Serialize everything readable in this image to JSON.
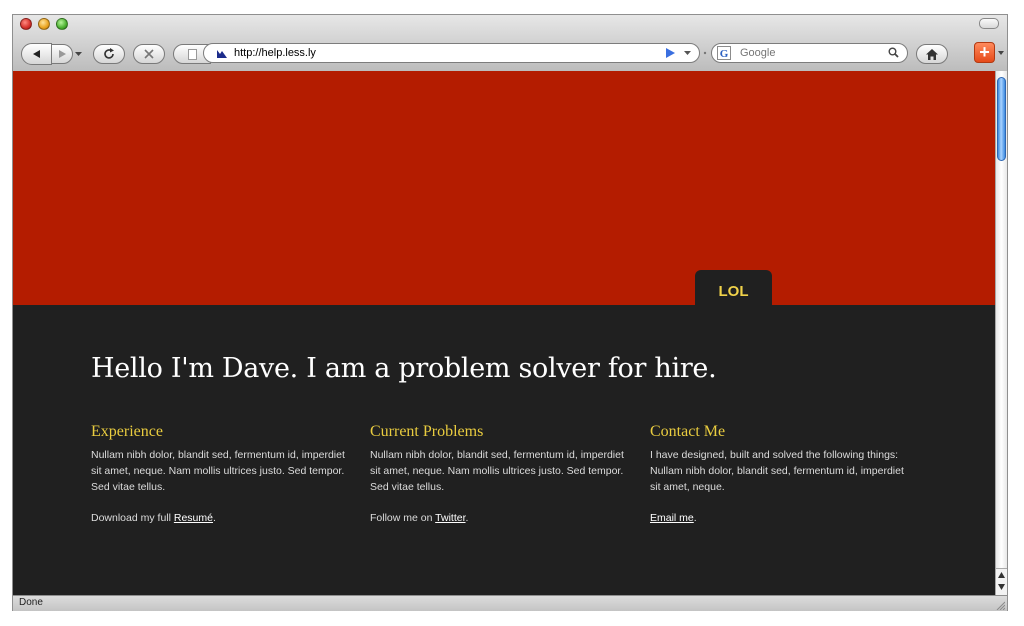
{
  "browser": {
    "url": "http://help.less.ly",
    "search_placeholder": "Google",
    "status": "Done"
  },
  "page": {
    "tab_label": "LOL",
    "headline": "Hello I'm Dave. I am a problem solver for hire.",
    "columns": [
      {
        "title": "Experience",
        "body": "Nullam nibh dolor, blandit sed, fermentum id, imperdiet sit amet, neque. Nam mollis ultrices justo. Sed tempor. Sed vitae tellus.",
        "foot_prefix": "Download my full ",
        "link": "Resumé",
        "foot_suffix": "."
      },
      {
        "title": "Current Problems",
        "body": "Nullam nibh dolor, blandit sed, fermentum id, imperdiet sit amet, neque. Nam mollis ultrices justo. Sed tempor. Sed vitae tellus.",
        "foot_prefix": "Follow me on ",
        "link": "Twitter",
        "foot_suffix": "."
      },
      {
        "title": "Contact Me",
        "body": "I have designed, built and solved the following things: Nullam nibh dolor, blandit sed, fermentum id, imperdiet sit amet, neque.",
        "foot_prefix": "",
        "link": "Email me",
        "foot_suffix": "."
      }
    ]
  },
  "colors": {
    "hero": "#b41c00",
    "content_bg": "#202020",
    "accent": "#e9cc3f"
  },
  "icons": {
    "back": "back-arrow-icon",
    "forward": "forward-arrow-icon",
    "reload": "reload-icon",
    "stop": "stop-icon",
    "home": "home-icon",
    "search": "magnifier-icon",
    "rss": "rss-icon",
    "plus": "plus-icon"
  }
}
